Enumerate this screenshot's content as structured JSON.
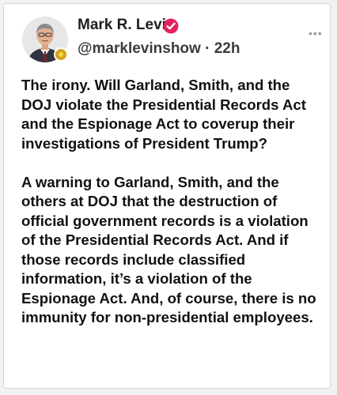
{
  "post": {
    "author": {
      "name": "Mark R. Levin",
      "handle": "@marklevinshow",
      "separator": "·",
      "time": "22h",
      "verified_icon": "verified-check-icon",
      "badge_icon": "gold-badge-icon"
    },
    "more_icon": "ellipsis-icon",
    "paragraphs": [
      "The irony.  Will Garland, Smith, and the DOJ violate the Presidential Records Act and the Espionage Act to coverup their investigations of President Trump?",
      "A warning to Garland, Smith, and the others at DOJ that the destruction of official government records is a violation of the Presidential Records Act.  And if those records include classified information, it’s a violation of the Espionage Act. And, of course, there is no immunity for non-presidential employees."
    ]
  },
  "colors": {
    "verified": "#e0245e",
    "badge": "#d4a21a"
  }
}
